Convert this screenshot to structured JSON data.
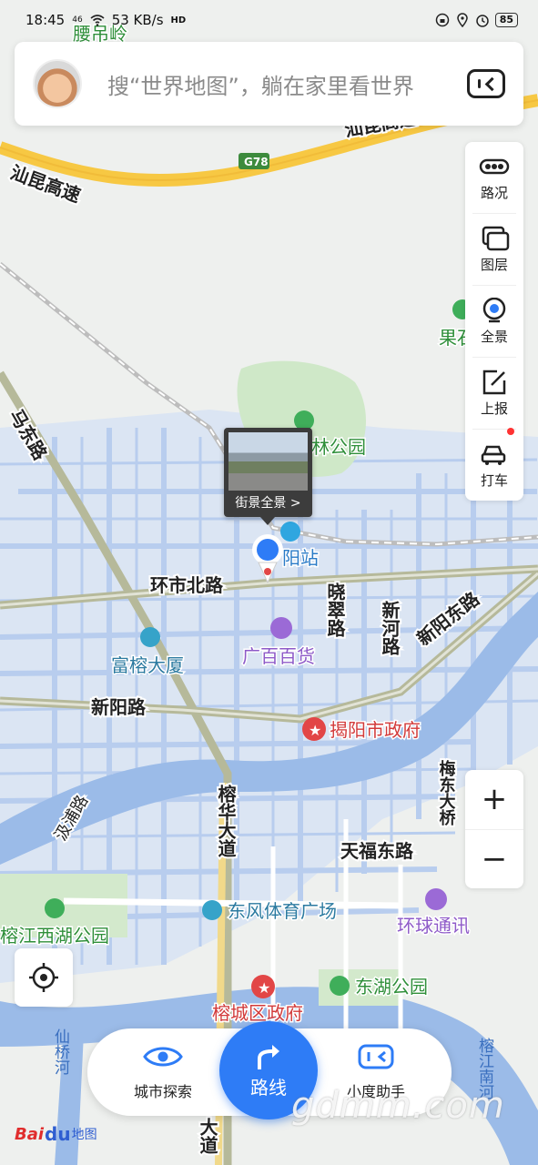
{
  "status_bar": {
    "time": "18:45",
    "network": "46",
    "speed": "53 KB/s",
    "hd": "HD",
    "battery": "85"
  },
  "search": {
    "placeholder": "搜“世界地图”，躺在家里看世界"
  },
  "toolbar": {
    "items": [
      {
        "label": "路况",
        "icon": "traffic-icon"
      },
      {
        "label": "图层",
        "icon": "layers-icon"
      },
      {
        "label": "全景",
        "icon": "panorama-icon"
      },
      {
        "label": "上报",
        "icon": "report-icon"
      },
      {
        "label": "打车",
        "icon": "taxi-icon"
      }
    ]
  },
  "zoom": {
    "in": "+",
    "out": "−"
  },
  "street_view_popup": {
    "label": "街景全景 >"
  },
  "map_labels": {
    "expressway_top_1": "汕昆高速",
    "expressway_top_2": "汕昆高速",
    "g78": "G78",
    "lingmanling": "腰吊岭",
    "guoyuan": "果石",
    "park_name": "林公园",
    "road_nw": "马东路",
    "station": "阳站",
    "huanshi_bei": "环市北路",
    "xiaocui": "晓翠路",
    "xinhe": "新河路",
    "xinyang_dong": "新阳东路",
    "furong": "富榕大厦",
    "guangbai": "广百百货",
    "xinyang": "新阳路",
    "gov": "揭阳市政府",
    "meidong": "梅东大桥",
    "qinpu": "汲浦路",
    "ronghua": "榕华大道",
    "tianfu": "天福东路",
    "dongfeng": "东风体育广场",
    "huanqiu": "环球通讯",
    "rongjiang_west": "榕江西湖公园",
    "donghu": "东湖公园",
    "rongcheng_gov": "榕城区政府",
    "xianqiao": "仙桥河",
    "rongjiang_south": "榕江南河",
    "dadao_bottom": "大道"
  },
  "bottom_nav": {
    "explore": "城市探索",
    "route": "路线",
    "assistant": "小度助手"
  },
  "logo": {
    "bai": "Bai",
    "du": "du",
    "ditu": "地图"
  },
  "watermark": "gdmm.com",
  "colors": {
    "accent": "#2e7cf6",
    "road_blue": "#aac6ec",
    "river": "#9bbbe8",
    "park": "#cfe8c8",
    "gov_red": "#e24646",
    "mall_purple": "#8e5ac8"
  }
}
